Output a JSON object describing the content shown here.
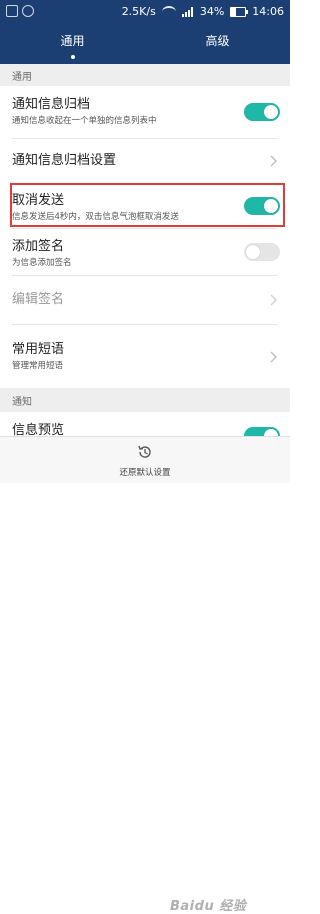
{
  "status_bar": {
    "network_speed": "2.5K/s",
    "battery": "34%",
    "battery_level": 0.34,
    "time": "14:06"
  },
  "tabs": [
    {
      "label": "通用",
      "active": true
    },
    {
      "label": "高级",
      "active": false
    }
  ],
  "sections": {
    "general": "通用",
    "notification": "通知"
  },
  "settings": [
    {
      "title": "通知信息归档",
      "subtitle": "通知信息收起在一个单独的信息列表中",
      "control": "toggle",
      "on": true
    },
    {
      "title": "通知信息归档设置",
      "control": "chevron"
    },
    {
      "title": "取消发送",
      "subtitle": "信息发送后4秒内，双击信息气泡框取消发送",
      "control": "toggle",
      "on": true
    },
    {
      "title": "添加签名",
      "subtitle": "为信息添加签名",
      "control": "toggle",
      "on": false
    },
    {
      "title": "编辑签名",
      "control": "chevron",
      "disabled": true
    },
    {
      "title": "常用短语",
      "subtitle": "管理常用短语",
      "control": "chevron"
    },
    {
      "title": "信息预览",
      "control": "toggle",
      "on": true
    }
  ],
  "bottom": {
    "restore_label": "还原默认设置",
    "restore_icon": "history-icon"
  },
  "watermark": "Baidu 经验",
  "colors": {
    "header_bg": "#1b3f73",
    "toggle_on": "#1fb7a8",
    "highlight": "#e23b3b"
  }
}
